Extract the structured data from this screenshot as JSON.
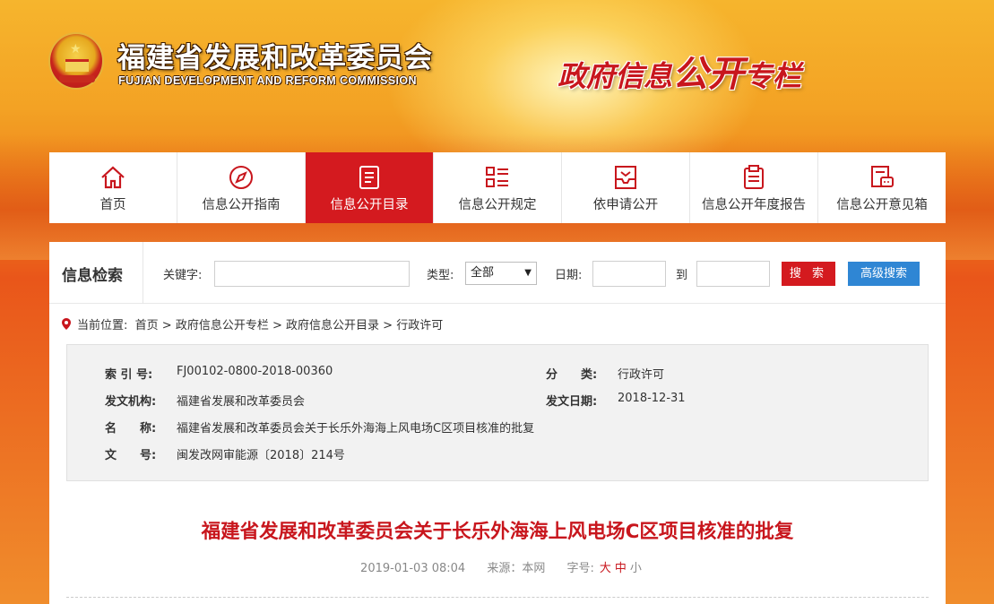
{
  "header": {
    "org_cn": "福建省发展和改革委员会",
    "org_en": "FUJIAN DEVELOPMENT AND REFORM COMMISSION",
    "column_title_a": "政府信息",
    "column_title_b": "公开",
    "column_title_c": "专栏"
  },
  "nav": {
    "items": [
      {
        "label": "首页",
        "icon": "home-icon"
      },
      {
        "label": "信息公开指南",
        "icon": "compass-icon"
      },
      {
        "label": "信息公开目录",
        "icon": "document-list-icon"
      },
      {
        "label": "信息公开规定",
        "icon": "rules-list-icon"
      },
      {
        "label": "依申请公开",
        "icon": "inbox-icon"
      },
      {
        "label": "信息公开年度报告",
        "icon": "clipboard-icon"
      },
      {
        "label": "信息公开意见箱",
        "icon": "feedback-icon"
      }
    ],
    "active": "信息公开目录"
  },
  "search": {
    "title": "信息检索",
    "keyword_label": "关键字:",
    "keyword_value": "",
    "type_label": "类型:",
    "type_value": "全部",
    "date_label": "日期:",
    "date_from": "",
    "to_label": "到",
    "date_to": "",
    "search_button": "搜 索",
    "advanced_button": "高级搜索"
  },
  "breadcrumb": {
    "label": "当前位置:",
    "items": [
      "首页",
      "政府信息公开专栏",
      "政府信息公开目录",
      "行政许可"
    ],
    "sep": " > "
  },
  "info": {
    "index_label": "索 引 号:",
    "index_value": "FJ00102-0800-2018-00360",
    "category_label": "分　　类:",
    "category_value": "行政许可",
    "publisher_label": "发文机构:",
    "publisher_value": "福建省发展和改革委员会",
    "date_label": "发文日期:",
    "date_value": "2018-12-31",
    "name_label": "名　　称:",
    "name_value": "福建省发展和改革委员会关于长乐外海海上风电场C区项目核准的批复",
    "doc_no_label": "文　　号:",
    "doc_no_value": "闽发改网审能源〔2018〕214号"
  },
  "article": {
    "title": "福建省发展和改革委员会关于长乐外海海上风电场C区项目核准的批复",
    "datetime": "2019-01-03 08:04",
    "source": "来源：本网",
    "fontsize_label": "字号:",
    "font_large": "大",
    "font_mid": "中",
    "font_small": "小"
  },
  "colors": {
    "brand_red": "#d41a1f",
    "accent_blue": "#2f86d4",
    "title_red": "#c8161d"
  }
}
